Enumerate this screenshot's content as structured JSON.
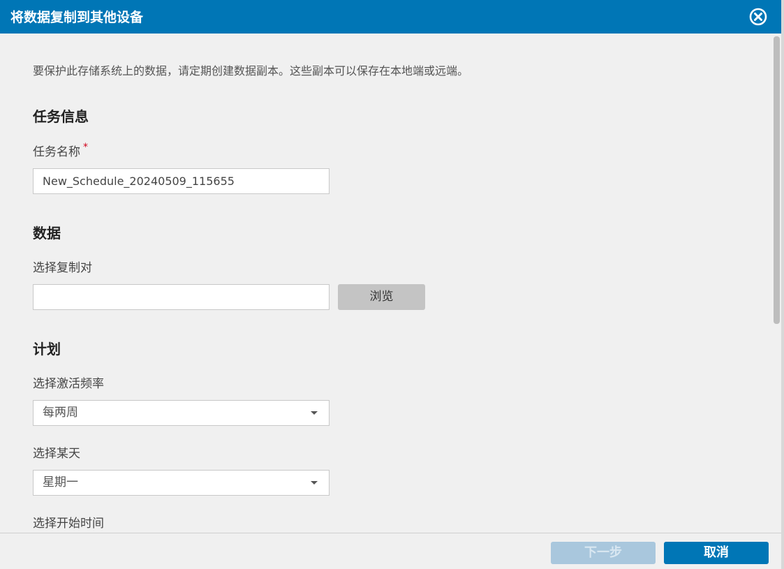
{
  "dialog": {
    "title": "将数据复制到其他设备",
    "close_icon": "close-circle-icon"
  },
  "intro": "要保护此存储系统上的数据，请定期创建数据副本。这些副本可以保存在本地端或远端。",
  "task_info": {
    "heading": "任务信息",
    "name_label": "任务名称",
    "required_mark": "*",
    "name_value": "New_Schedule_20240509_115655"
  },
  "data_section": {
    "heading": "数据",
    "select_label": "选择复制对",
    "select_value": "",
    "browse_label": "浏览"
  },
  "schedule": {
    "heading": "计划",
    "frequency_label": "选择激活频率",
    "frequency_value": "每两周",
    "day_label": "选择某天",
    "day_value": "星期一",
    "start_time_label": "选择开始时间"
  },
  "footer": {
    "next_label": "下一步",
    "cancel_label": "取消"
  },
  "colors": {
    "header": "#0076b6",
    "primary_button": "#0076b6",
    "disabled_button": "#a9c7dd",
    "background": "#f0f0f0"
  }
}
